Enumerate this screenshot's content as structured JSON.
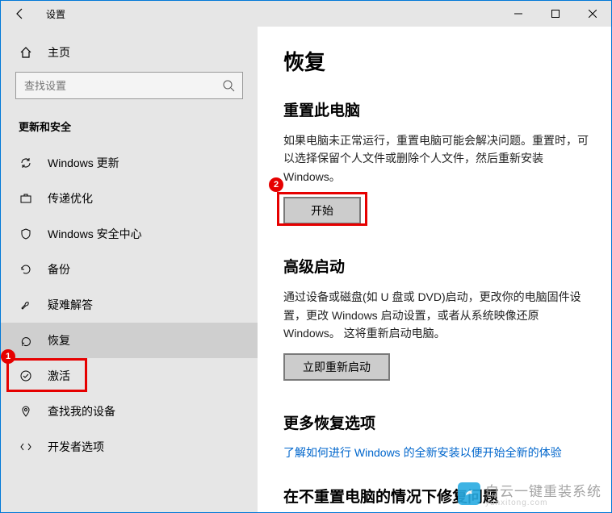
{
  "window": {
    "title": "设置"
  },
  "sidebar": {
    "home": "主页",
    "search_placeholder": "查找设置",
    "section": "更新和安全",
    "items": [
      {
        "label": "Windows 更新"
      },
      {
        "label": "传递优化"
      },
      {
        "label": "Windows 安全中心"
      },
      {
        "label": "备份"
      },
      {
        "label": "疑难解答"
      },
      {
        "label": "恢复"
      },
      {
        "label": "激活"
      },
      {
        "label": "查找我的设备"
      },
      {
        "label": "开发者选项"
      }
    ]
  },
  "main": {
    "title": "恢复",
    "reset": {
      "heading": "重置此电脑",
      "desc": "如果电脑未正常运行，重置电脑可能会解决问题。重置时，可以选择保留个人文件或删除个人文件，然后重新安装 Windows。",
      "button": "开始"
    },
    "advanced": {
      "heading": "高级启动",
      "desc": "通过设备或磁盘(如 U 盘或 DVD)启动，更改你的电脑固件设置，更改 Windows 启动设置，或者从系统映像还原 Windows。 这将重新启动电脑。",
      "button": "立即重新启动"
    },
    "more": {
      "heading": "更多恢复选项",
      "link": "了解如何进行 Windows 的全新安装以便开始全新的体验"
    },
    "footer_partial": "在不重置电脑的情况下修复问题"
  },
  "annotations": {
    "badge1": "1",
    "badge2": "2"
  },
  "watermark": {
    "text": "白云一键重装系统",
    "url": "yunxitong.com"
  }
}
